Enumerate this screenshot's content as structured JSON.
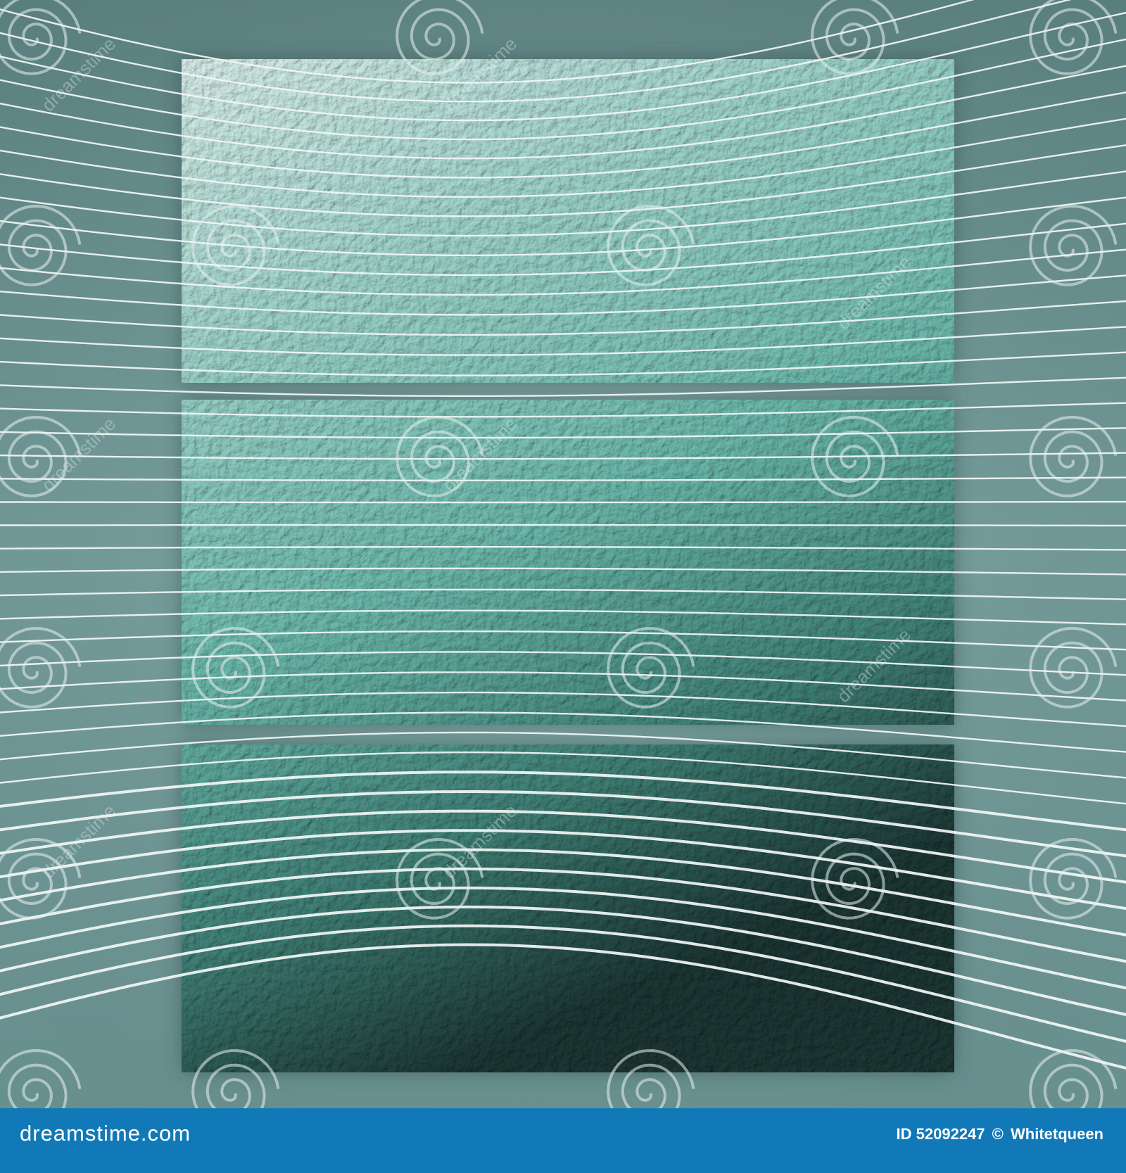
{
  "colors": {
    "background_outer": "#5f8585",
    "background_mid": "#7ea7a5",
    "panel_light": "#cfe8e4",
    "panel_mid": "#6fb6ab",
    "panel_dark": "#1f3a37",
    "wave_line": "#f2f7f6",
    "watermark": "#e8f2f1",
    "footer_bar": "#1279b8",
    "footer_text": "#ffffff"
  },
  "artwork": {
    "description_icons": [
      "spiral-watermark-icon",
      "diagonal-watermark-text"
    ],
    "watermark_text": "dreamstime",
    "panel_count": 3,
    "wave_line_count": 44
  },
  "footer": {
    "site_logo": "dreamstime.com",
    "id_label": "ID 52092247",
    "copyright_symbol": "©",
    "author": "Whitetqueen"
  }
}
